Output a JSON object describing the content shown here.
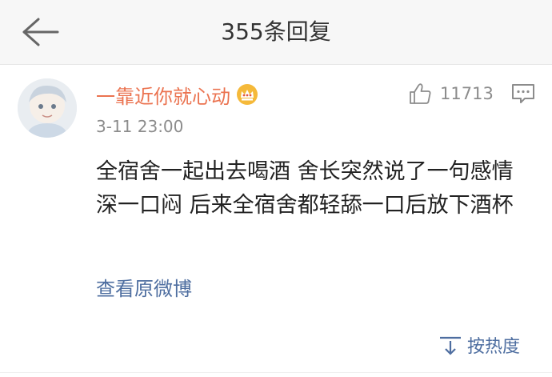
{
  "header": {
    "title": "355条回复"
  },
  "comment": {
    "username": "一靠近你就心动",
    "timestamp": "3-11 23:00",
    "like_count": "11713",
    "text": "全宿舍一起出去喝酒 舍长突然说了一句感情深一口闷 后来全宿舍都轻舔一口后放下酒杯",
    "view_original_label": "查看原微博"
  },
  "footer": {
    "sort_label": "按热度"
  },
  "colors": {
    "username": "#eb7350",
    "link": "#4e6ea0",
    "muted": "#8c8c8c",
    "header_bg": "#f7f7f7"
  },
  "icons": {
    "back": "back-arrow-icon",
    "crown": "crown-icon",
    "like": "thumbs-up-icon",
    "comment": "comment-icon",
    "sort": "sort-icon"
  }
}
